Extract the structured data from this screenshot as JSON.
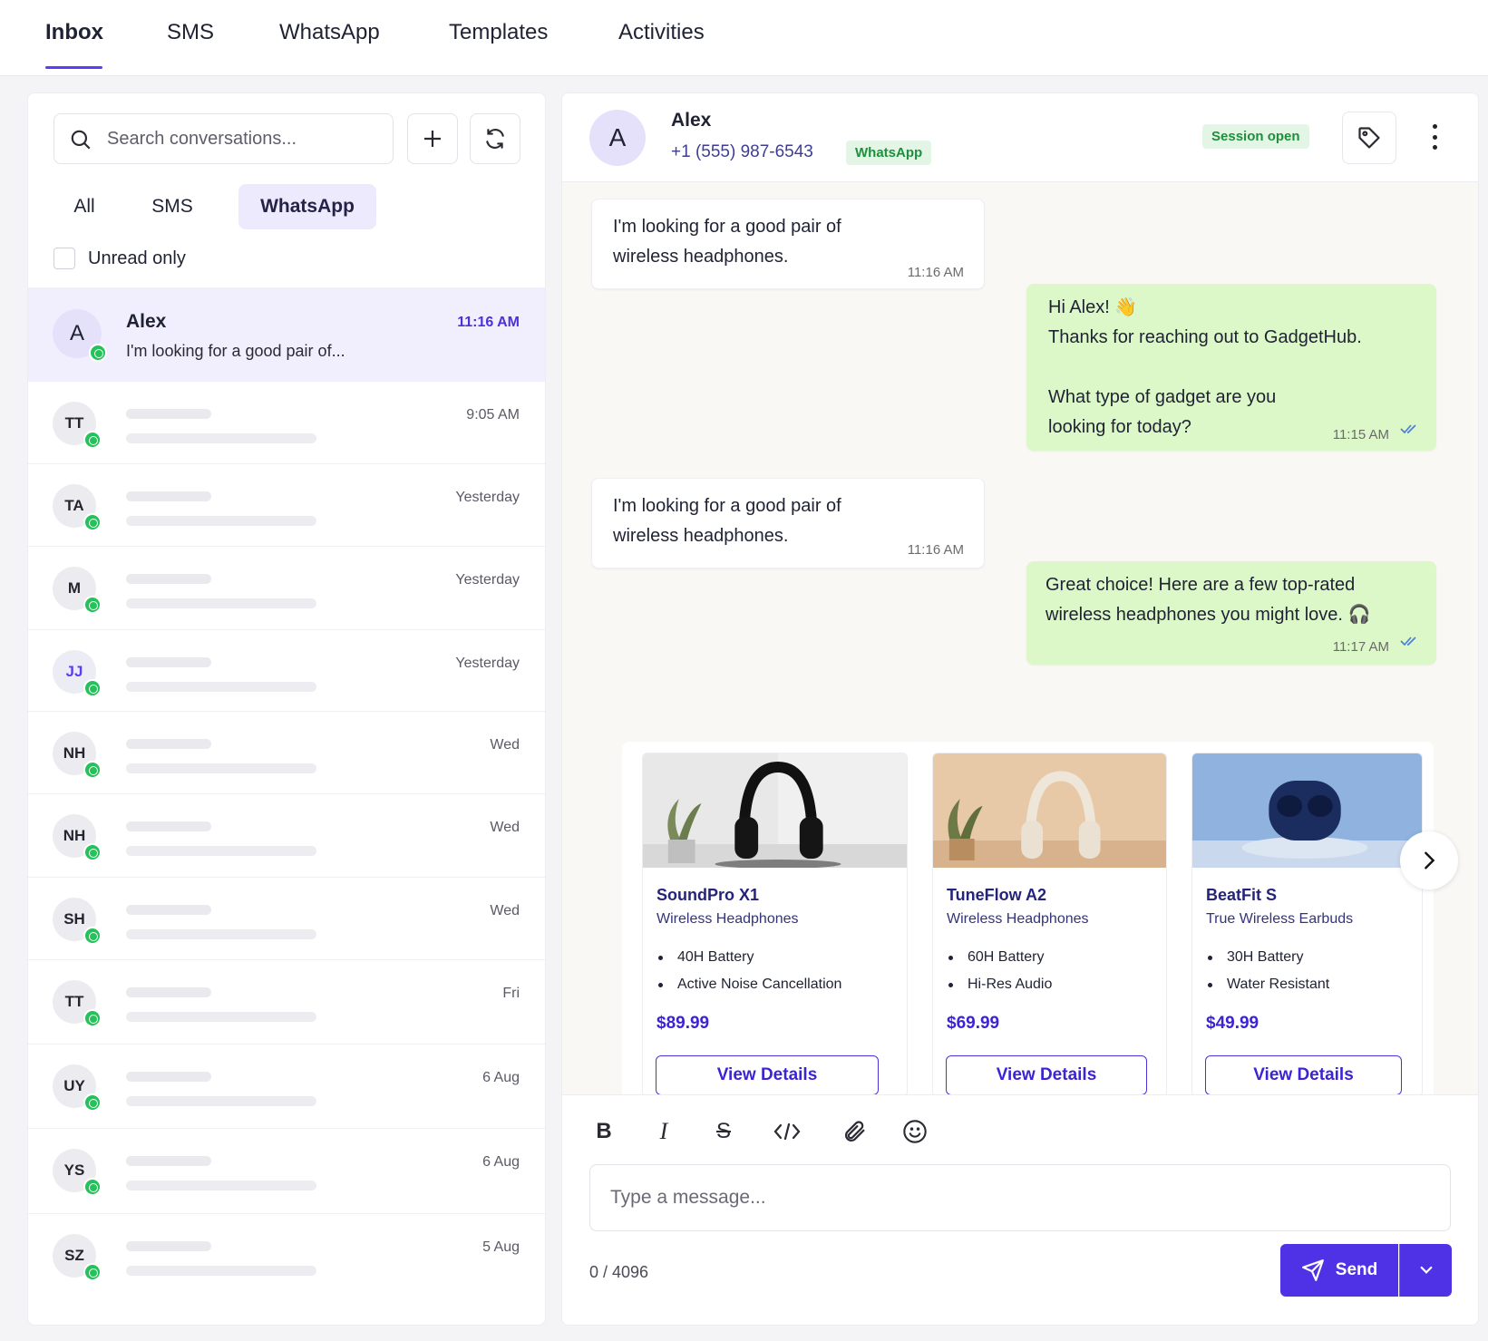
{
  "nav": {
    "tabs": [
      "Inbox",
      "SMS",
      "WhatsApp",
      "Templates",
      "Activities"
    ],
    "active": "Inbox"
  },
  "sidebar": {
    "search_placeholder": "Search conversations...",
    "filters": [
      "All",
      "SMS",
      "WhatsApp"
    ],
    "active_filter": "WhatsApp",
    "unread_label": "Unread only",
    "conversations": [
      {
        "initials": "A",
        "name": "Alex",
        "preview": "I'm looking for a good pair of...",
        "time": "11:16 AM",
        "selected": true
      },
      {
        "initials": "TT",
        "time": "9:05 AM"
      },
      {
        "initials": "TA",
        "time": "Yesterday"
      },
      {
        "initials": "M",
        "time": "Yesterday"
      },
      {
        "initials": "JJ",
        "time": "Yesterday"
      },
      {
        "initials": "NH",
        "time": "Wed"
      },
      {
        "initials": "NH",
        "time": "Wed"
      },
      {
        "initials": "SH",
        "time": "Wed"
      },
      {
        "initials": "TT",
        "time": "Fri"
      },
      {
        "initials": "UY",
        "time": "6 Aug"
      },
      {
        "initials": "YS",
        "time": "6 Aug"
      },
      {
        "initials": "SZ",
        "time": "5 Aug"
      }
    ]
  },
  "chat": {
    "contact": {
      "initial": "A",
      "name": "Alex",
      "phone": "+1 (555) 987-6543",
      "channel": "WhatsApp"
    },
    "session_status": "Session open",
    "messages": [
      {
        "dir": "in",
        "text": "I'm looking for a good pair of\nwireless headphones.",
        "time": "11:16 AM"
      },
      {
        "dir": "out",
        "text": "Hi Alex! 👋\nThanks for reaching out to GadgetHub.\n\nWhat type of gadget are you\nlooking for today?",
        "time": "11:15 AM"
      },
      {
        "dir": "in",
        "text": "I'm looking for a good pair of\nwireless headphones.",
        "time": "11:16 AM"
      },
      {
        "dir": "out",
        "text": "Great choice! Here are a few top-rated\nwireless headphones you might love. 🎧",
        "time": "11:17 AM"
      }
    ],
    "products": [
      {
        "name": "SoundPro X1",
        "subtitle": "Wireless Headphones",
        "features": [
          "40H Battery",
          "Active Noise Cancellation"
        ],
        "price": "$89.99",
        "button": "View Details"
      },
      {
        "name": "TuneFlow A2",
        "subtitle": "Wireless Headphones",
        "features": [
          "60H Battery",
          "Hi-Res Audio"
        ],
        "price": "$69.99",
        "button": "View Details"
      },
      {
        "name": "BeatFit S",
        "subtitle": "True Wireless Earbuds",
        "features": [
          "30H Battery",
          "Water Resistant"
        ],
        "price": "$49.99",
        "button": "View Details"
      }
    ]
  },
  "composer": {
    "placeholder": "Type a message...",
    "counter": "0 / 4096",
    "send_label": "Send"
  },
  "colors": {
    "accent": "#4f32e6",
    "outgoing_bubble": "#dcf7c8",
    "whatsapp_green": "#25c15a",
    "session_badge": "#1e8f3d"
  }
}
